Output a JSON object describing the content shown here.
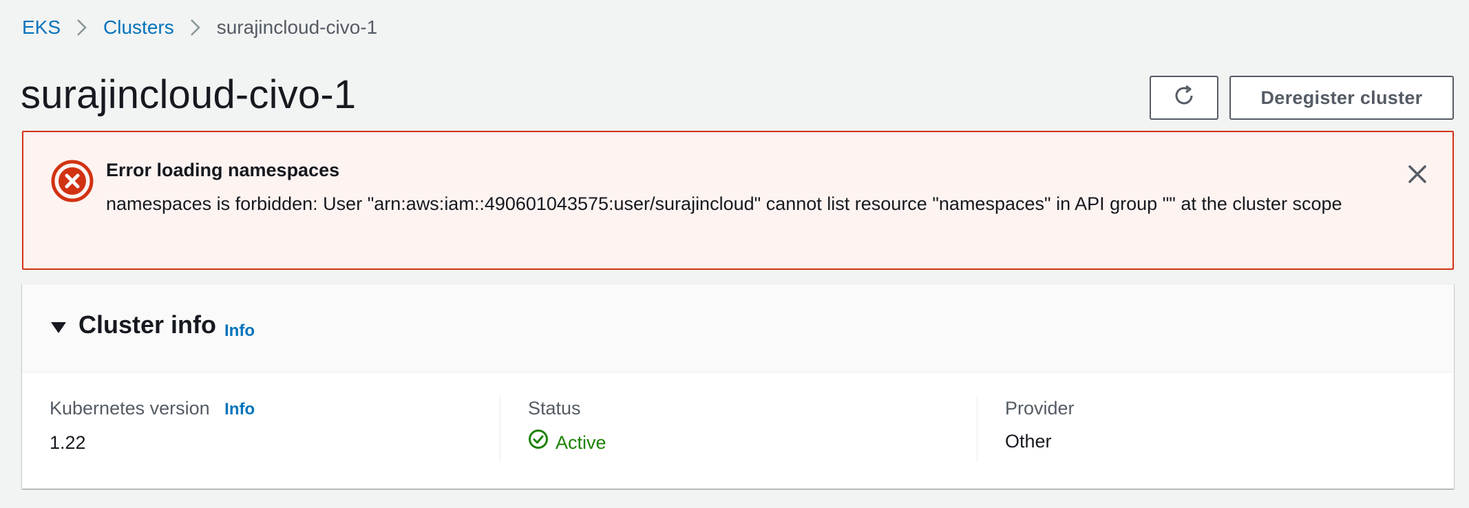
{
  "breadcrumb": {
    "items": [
      {
        "label": "EKS"
      },
      {
        "label": "Clusters"
      },
      {
        "label": "surajincloud-civo-1"
      }
    ]
  },
  "header": {
    "title": "surajincloud-civo-1",
    "refresh_icon": "refresh-icon",
    "deregister_label": "Deregister cluster"
  },
  "alert": {
    "type": "error",
    "icon": "error-circle-x-icon",
    "title": "Error loading namespaces",
    "message": "namespaces is forbidden: User \"arn:aws:iam::490601043575:user/surajincloud\" cannot list resource \"namespaces\" in API group \"\" at the cluster scope",
    "close_icon": "close-icon"
  },
  "cluster_info": {
    "title": "Cluster info",
    "info_label": "Info",
    "expanded": true,
    "columns": [
      {
        "label": "Kubernetes version",
        "info_label": "Info",
        "value": "1.22"
      },
      {
        "label": "Status",
        "value": "Active",
        "icon": "check-circle-icon"
      },
      {
        "label": "Provider",
        "value": "Other"
      }
    ]
  },
  "colors": {
    "link": "#0073bb",
    "error": "#d13212",
    "error_bg": "#fdf3f1",
    "success": "#1d8102",
    "page_bg": "#f2f3f3"
  }
}
